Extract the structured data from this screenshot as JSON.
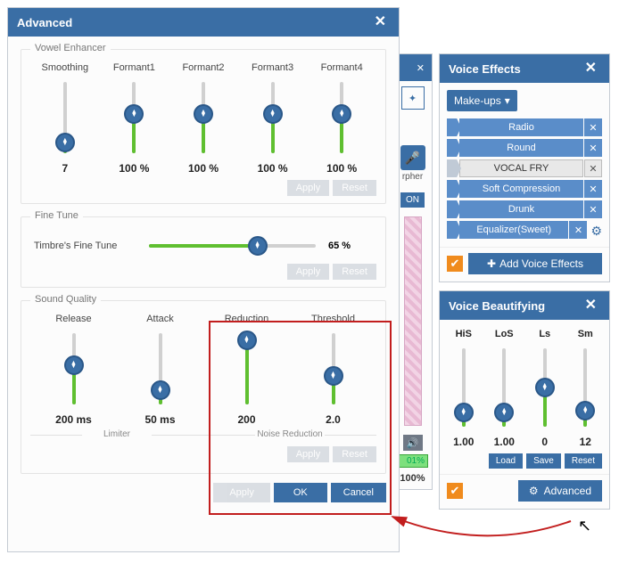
{
  "advanced": {
    "title": "Advanced",
    "vowel_enhancer": {
      "legend": "Vowel Enhancer",
      "sliders": [
        {
          "label": "Smoothing",
          "value": "7",
          "pct": 15
        },
        {
          "label": "Formant1",
          "value": "100 %",
          "pct": 55
        },
        {
          "label": "Formant2",
          "value": "100 %",
          "pct": 55
        },
        {
          "label": "Formant3",
          "value": "100 %",
          "pct": 55
        },
        {
          "label": "Formant4",
          "value": "100 %",
          "pct": 55
        }
      ],
      "apply": "Apply",
      "reset": "Reset"
    },
    "fine_tune": {
      "legend": "Fine Tune",
      "label": "Timbre's Fine Tune",
      "value": "65 %",
      "pct": 65,
      "apply": "Apply",
      "reset": "Reset"
    },
    "sound_quality": {
      "legend": "Sound Quality",
      "limiter": {
        "legend": "Limiter",
        "sliders": [
          {
            "label": "Release",
            "value": "200 ms",
            "pct": 55
          },
          {
            "label": "Attack",
            "value": "50 ms",
            "pct": 20
          }
        ]
      },
      "noise_reduction": {
        "legend": "Noise Reduction",
        "sliders": [
          {
            "label": "Reduction",
            "value": "200",
            "pct": 90
          },
          {
            "label": "Threshold",
            "value": "2.0",
            "pct": 40
          }
        ],
        "apply": "Apply",
        "reset": "Reset"
      }
    },
    "footer": {
      "apply": "Apply",
      "ok": "OK",
      "cancel": "Cancel"
    }
  },
  "voice_effects": {
    "title": "Voice Effects",
    "dropdown": "Make-ups",
    "items": [
      {
        "label": "Radio",
        "active": true
      },
      {
        "label": "Round",
        "active": true
      },
      {
        "label": "VOCAL FRY",
        "active": false
      },
      {
        "label": "Soft Compression",
        "active": true
      },
      {
        "label": "Drunk",
        "active": true
      },
      {
        "label": "Equalizer(Sweet)",
        "active": true,
        "gear": true
      }
    ],
    "add": "Add Voice Effects"
  },
  "voice_beautifying": {
    "title": "Voice Beautifying",
    "sliders": [
      {
        "label": "HiS",
        "value": "1.00",
        "pct": 18
      },
      {
        "label": "LoS",
        "value": "1.00",
        "pct": 18
      },
      {
        "label": "Ls",
        "value": "0",
        "pct": 50
      },
      {
        "label": "Sm",
        "value": "12",
        "pct": 20
      }
    ],
    "load": "Load",
    "save": "Save",
    "reset": "Reset",
    "advanced": "Advanced"
  },
  "background_strip": {
    "morpher": "rpher",
    "on": "ON",
    "pct": "01%",
    "hundred": "100%"
  }
}
